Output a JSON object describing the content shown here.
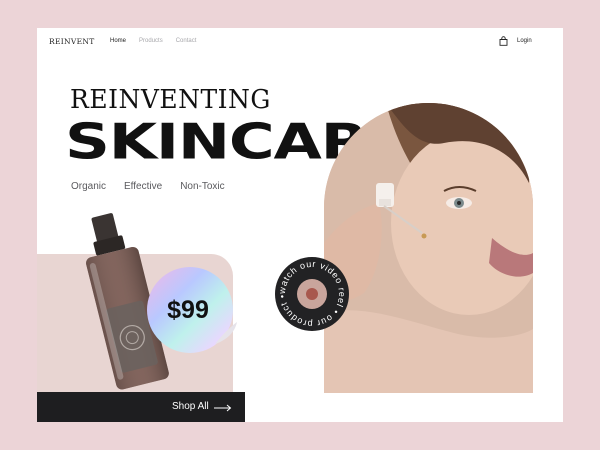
{
  "brand": {
    "logo": "REINVENT"
  },
  "nav": {
    "items": [
      {
        "label": "Home",
        "active": true
      },
      {
        "label": "Products",
        "active": false
      },
      {
        "label": "Contact",
        "active": false
      }
    ],
    "login": "Login",
    "cart_icon": "shopping-bag-icon"
  },
  "hero": {
    "line1": "REINVENTING",
    "line2": "SKINCARE",
    "tags": [
      "Organic",
      "Effective",
      "Non-Toxic"
    ]
  },
  "product": {
    "price": "$99",
    "cta": "Shop All",
    "cta_icon": "arrow-right-icon"
  },
  "video_badge": {
    "text": "watch our video reel • our product •",
    "icon": "play-icon"
  },
  "colors": {
    "page_background": "#ecd4d7",
    "card_background": "#ffffff",
    "accent_dark": "#1e1e20",
    "product_backdrop": "#e8d5d2"
  }
}
